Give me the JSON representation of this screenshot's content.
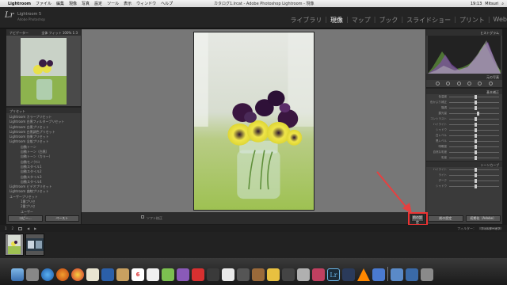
{
  "menubar": {
    "apple": "",
    "app": "Lightroom",
    "menus": [
      "ファイル",
      "編集",
      "現像",
      "写真",
      "設定",
      "ツール",
      "表示",
      "ウィンドウ",
      "ヘルプ"
    ],
    "window_title": "カタログ1.lrcat - Adobe Photoshop Lightroom - 現像",
    "clock": "19:13",
    "user": "Mitsuri"
  },
  "header": {
    "logo": "Lr",
    "product": "Lightroom 5",
    "sub": "Adobe Photoshop",
    "modules": [
      "ライブラリ",
      "現像",
      "マップ",
      "ブック",
      "スライドショー",
      "プリント",
      "Web"
    ],
    "active_module": "現像"
  },
  "left": {
    "navigator_title": "ナビゲーター",
    "navigator_zoom": "全体  フィット  100%  1:3",
    "presets_title": "プリセット",
    "presets": [
      {
        "label": "Lightroom カラープリセット",
        "level": 1
      },
      {
        "label": "Lightroom 白黒フィルタープリセット",
        "level": 1
      },
      {
        "label": "Lightroom 白黒プリセット",
        "level": 1
      },
      {
        "label": "Lightroom 白黒調色プリセット",
        "level": 1
      },
      {
        "label": "Lightroom 効果プリセット",
        "level": 1
      },
      {
        "label": "Lightroom 全般プリセット",
        "level": 1
      },
      {
        "label": "自動トーン",
        "level": 2
      },
      {
        "label": "自動トーン（白黒）",
        "level": 2
      },
      {
        "label": "自動トーン（カラー）",
        "level": 2
      },
      {
        "label": "自動モノクロ",
        "level": 2
      },
      {
        "label": "自動スタイル1",
        "level": 2
      },
      {
        "label": "自動スタイル2",
        "level": 2
      },
      {
        "label": "自動スタイル3",
        "level": 2
      },
      {
        "label": "自動スタイル4",
        "level": 2
      },
      {
        "label": "Lightroom ビデオプリセット",
        "level": 1
      },
      {
        "label": "Lightroom 曲線プリセット",
        "level": 1
      },
      {
        "label": "ユーザープリセット",
        "level": 1
      },
      {
        "label": "1番プリセ",
        "level": 2
      },
      {
        "label": "2番プリセ",
        "level": 2
      },
      {
        "label": "ユーザー",
        "level": 2
      },
      {
        "label": "白黒",
        "level": 2
      }
    ],
    "copy_button": "コピー...",
    "paste_button": "ペースト"
  },
  "right": {
    "histogram_title": "ヒストグラム",
    "original_label": "元の写真",
    "basic_title": "基本補正",
    "sliders": [
      {
        "label": "色温度",
        "value": "",
        "pos": 0.5
      },
      {
        "label": "色かぶり補正",
        "value": "",
        "pos": 0.5
      },
      {
        "label": "階調",
        "value": "",
        "pos": 0.5
      },
      {
        "label": "露光量",
        "value": "",
        "pos": 0.55
      },
      {
        "label": "コントラスト",
        "value": "",
        "pos": 0.5
      },
      {
        "label": "ハイライト",
        "value": "",
        "pos": 0.5
      },
      {
        "label": "シャドウ",
        "value": "",
        "pos": 0.5
      },
      {
        "label": "白レベル",
        "value": "",
        "pos": 0.5
      },
      {
        "label": "黒レベル",
        "value": "",
        "pos": 0.5
      },
      {
        "label": "明瞭度",
        "value": "",
        "pos": 0.5
      },
      {
        "label": "自然な彩度",
        "value": "",
        "pos": 0.5
      },
      {
        "label": "彩度",
        "value": "",
        "pos": 0.5
      }
    ],
    "tone_title": "トーンカーブ",
    "tone_sliders": [
      {
        "label": "ハイライト",
        "pos": 0.5
      },
      {
        "label": "ライト",
        "pos": 0.5
      },
      {
        "label": "ダーク",
        "pos": 0.5
      },
      {
        "label": "シャドウ",
        "pos": 0.5
      }
    ],
    "prev_settings_button": "前の設定",
    "reset_button": "初期化（Adobe）"
  },
  "toolbar": {
    "soft_proof_left": "",
    "soft_proof_check_label": "校正",
    "soft_proof": "ソフト校正",
    "previous_button": "前の設定"
  },
  "filmstrip": {
    "page1": "1",
    "page2": "2",
    "source_info": "",
    "filter_label": "フィルター：",
    "filter_value": "フィルターオフ"
  },
  "dock": {
    "calendar_day": "6",
    "lr_logo": "Lr"
  },
  "colors": {
    "accent_red": "#e03030",
    "panel_bg": "#3a3a3a",
    "canvas_bg": "#777777"
  }
}
